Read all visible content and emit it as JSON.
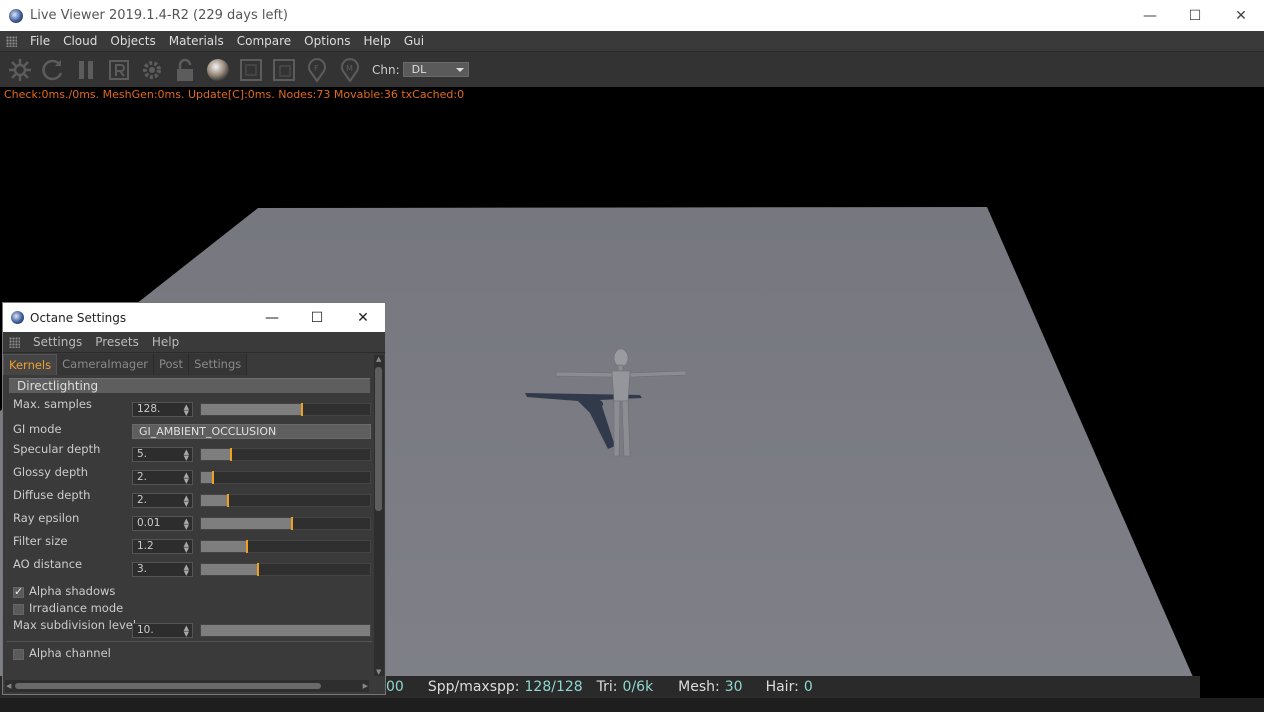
{
  "window": {
    "title": "Live Viewer 2019.1.4-R2 (229 days left)",
    "minimize": "—",
    "maximize": "☐",
    "close": "✕"
  },
  "menu": [
    "File",
    "Cloud",
    "Objects",
    "Materials",
    "Compare",
    "Options",
    "Help",
    "Gui"
  ],
  "toolbar": {
    "channel_label": "Chn:",
    "channel_value": "DL"
  },
  "status_line": "Check:0ms./0ms. MeshGen:0ms. Update[C]:0ms. Nodes:73 Movable:36 txCached:0",
  "bottom_bar": {
    "partial_value": "00",
    "spp_label": "Spp/maxspp:",
    "spp_value": "128/128",
    "tri_label": "Tri:",
    "tri_value": "0/6k",
    "mesh_label": "Mesh:",
    "mesh_value": "30",
    "hair_label": "Hair:",
    "hair_value": "0"
  },
  "octane_settings": {
    "title": "Octane Settings",
    "menu": [
      "Settings",
      "Presets",
      "Help"
    ],
    "tabs": [
      "Kernels",
      "CameraImager",
      "Post",
      "Settings"
    ],
    "active_tab": "Kernels",
    "section": "Directlighting",
    "params": [
      {
        "label": "Max. samples",
        "value": "128.",
        "fraction": 0.6
      },
      {
        "label": "Specular depth",
        "value": "5.",
        "fraction": 0.18
      },
      {
        "label": "Glossy depth",
        "value": "2.",
        "fraction": 0.07
      },
      {
        "label": "Diffuse depth",
        "value": "2.",
        "fraction": 0.16
      },
      {
        "label": "Ray epsilon",
        "value": "0.01",
        "fraction": 0.54
      },
      {
        "label": "Filter size",
        "value": "1.2",
        "fraction": 0.27
      },
      {
        "label": "AO distance",
        "value": "3.",
        "fraction": 0.34
      }
    ],
    "gi_mode": {
      "label": "GI mode",
      "value": "GI_AMBIENT_OCCLUSION"
    },
    "alpha_shadows": {
      "label": "Alpha shadows",
      "checked": true
    },
    "irradiance_mode": {
      "label": "Irradiance mode",
      "checked": false
    },
    "max_subdivision": {
      "label": "Max subdivision level",
      "value": "10.",
      "fraction": 1.0
    },
    "alpha_channel": {
      "label": "Alpha channel",
      "checked": false
    }
  },
  "colors": {
    "accent": "#f0a020",
    "status_text": "#e06a1c",
    "stat_values": "#8ed8cf",
    "floor": "#7b7c84"
  }
}
